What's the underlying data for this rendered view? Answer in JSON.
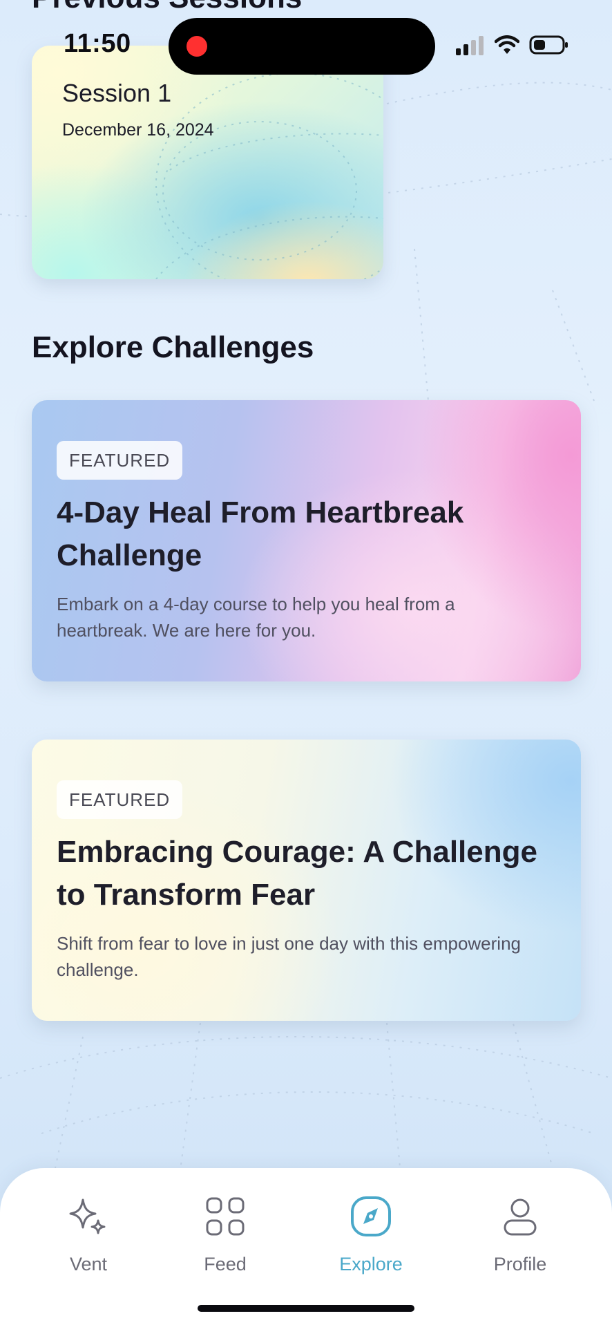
{
  "status_bar": {
    "time": "11:50"
  },
  "previous_sessions": {
    "title": "Previous Sessions",
    "sessions": [
      {
        "name": "Session 1",
        "date": "December 16, 2024"
      }
    ]
  },
  "explore": {
    "title": "Explore Challenges",
    "challenges": [
      {
        "badge": "FEATURED",
        "title": "4-Day Heal From Heartbreak Challenge",
        "description": "Embark on a 4-day course to help you heal from a heartbreak. We are here for you."
      },
      {
        "badge": "FEATURED",
        "title": "Embracing Courage: A Challenge to Transform Fear",
        "description": "Shift from fear to love in just one day with this empowering challenge."
      }
    ]
  },
  "nav": {
    "active": "Explore",
    "active_color": "#4aa8c9",
    "items": [
      {
        "label": "Vent",
        "icon": "sparkle-icon"
      },
      {
        "label": "Feed",
        "icon": "grid-icon"
      },
      {
        "label": "Explore",
        "icon": "compass-icon"
      },
      {
        "label": "Profile",
        "icon": "person-icon"
      }
    ]
  }
}
